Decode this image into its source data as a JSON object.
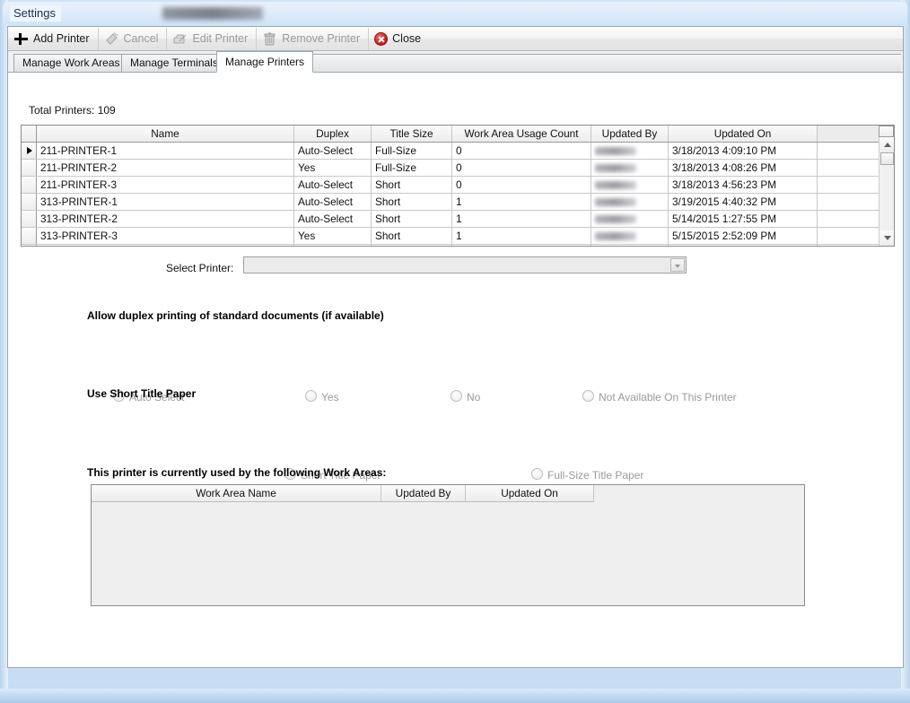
{
  "window": {
    "title": "Settings",
    "redacted_title_present": true
  },
  "toolbar": {
    "buttons": [
      {
        "label": "Add Printer",
        "icon": "plus-icon",
        "enabled": true
      },
      {
        "label": "Cancel",
        "icon": "cancel-icon",
        "enabled": false
      },
      {
        "label": "Edit Printer",
        "icon": "edit-printer-icon",
        "enabled": false
      },
      {
        "label": "Remove Printer",
        "icon": "trash-icon",
        "enabled": false
      },
      {
        "label": "Close",
        "icon": "close-circle-icon",
        "enabled": true
      }
    ]
  },
  "tabs": [
    {
      "label": "Manage Work Areas",
      "active": false
    },
    {
      "label": "Manage Terminals",
      "active": false
    },
    {
      "label": "Manage Printers",
      "active": true
    }
  ],
  "main": {
    "total_printers_label": "Total Printers:  109",
    "printers_grid": {
      "columns": [
        "Name",
        "Duplex",
        "Title Size",
        "Work Area Usage Count",
        "Updated By",
        "Updated On"
      ],
      "rows": [
        {
          "name": "211-PRINTER-1",
          "duplex": "Auto-Select",
          "title_size": "Full-Size",
          "usage_count": "0",
          "updated_by": "",
          "updated_on": "3/18/2013 4:09:10 PM",
          "selected": true
        },
        {
          "name": "211-PRINTER-2",
          "duplex": "Yes",
          "title_size": "Full-Size",
          "usage_count": "0",
          "updated_by": "",
          "updated_on": "3/18/2013 4:08:26 PM",
          "selected": false
        },
        {
          "name": "211-PRINTER-3",
          "duplex": "Auto-Select",
          "title_size": "Short",
          "usage_count": "0",
          "updated_by": "",
          "updated_on": "3/18/2013 4:56:23 PM",
          "selected": false
        },
        {
          "name": "313-PRINTER-1",
          "duplex": "Auto-Select",
          "title_size": "Short",
          "usage_count": "1",
          "updated_by": "",
          "updated_on": "3/19/2015 4:40:32 PM",
          "selected": false
        },
        {
          "name": "313-PRINTER-2",
          "duplex": "Auto-Select",
          "title_size": "Short",
          "usage_count": "1",
          "updated_by": "",
          "updated_on": "5/14/2015 1:27:55 PM",
          "selected": false
        },
        {
          "name": "313-PRINTER-3",
          "duplex": "Yes",
          "title_size": "Short",
          "usage_count": "1",
          "updated_by": "",
          "updated_on": "5/15/2015 2:52:09 PM",
          "selected": false
        }
      ]
    },
    "select_printer": {
      "label": "Select Printer:",
      "value": "",
      "placeholder": "",
      "enabled": false
    },
    "duplex_section": {
      "heading": "Allow duplex printing of standard documents (if available)",
      "options": [
        {
          "label": "Auto Select",
          "checked": false
        },
        {
          "label": "Yes",
          "checked": false
        },
        {
          "label": "No",
          "checked": false
        },
        {
          "label": "Not Available On This Printer",
          "checked": false
        }
      ]
    },
    "title_paper_section": {
      "heading": "Use Short Title Paper",
      "options": [
        {
          "label": "Short Title Paper",
          "checked": false
        },
        {
          "label": "Full-Size Title Paper",
          "checked": false
        }
      ]
    },
    "work_areas_section": {
      "heading": "This printer is currently used by the following Work Areas:",
      "columns": [
        "Work Area Name",
        "Updated By",
        "Updated On"
      ],
      "rows": []
    }
  },
  "colors": {
    "accent_blue": "#cfe3f7",
    "close_red": "#c21a1a",
    "grid_border": "#8b8b8b",
    "disabled_text": "#9a9a9a"
  }
}
